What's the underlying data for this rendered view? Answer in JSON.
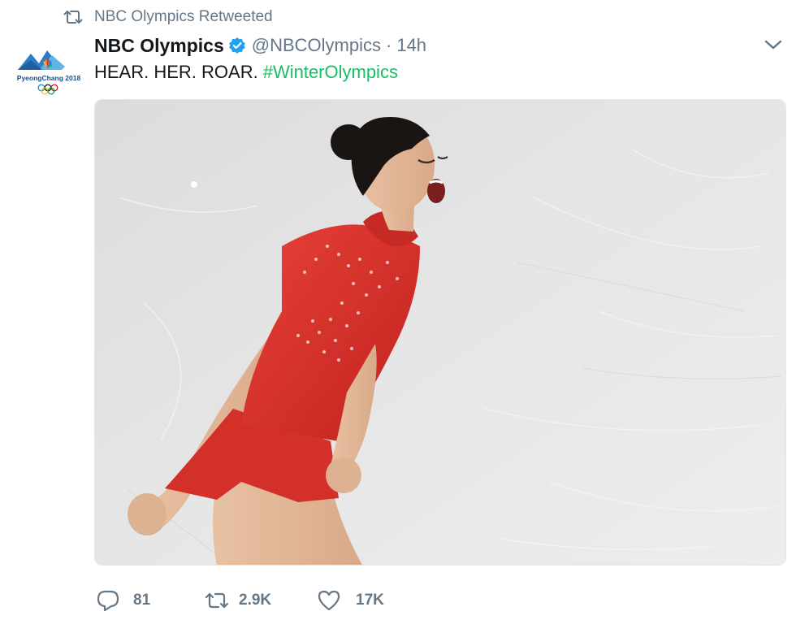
{
  "retweet_context": {
    "icon": "retweet-icon",
    "text": "NBC Olympics Retweeted"
  },
  "author": {
    "avatar_text": "PyeongChang 2018",
    "display_name": "NBC Olympics",
    "verified_icon": "verified-badge-icon",
    "handle": "@NBCOlympics",
    "separator": "·",
    "time": "14h"
  },
  "menu": {
    "icon": "chevron-down-icon"
  },
  "tweet": {
    "text": "HEAR. HER. ROAR.",
    "hashtag": "#WinterOlympics"
  },
  "media": {
    "type": "photo"
  },
  "actions": {
    "reply": {
      "icon": "reply-icon",
      "count": "81"
    },
    "retweet": {
      "icon": "retweet-icon",
      "count": "2.9K"
    },
    "like": {
      "icon": "heart-icon",
      "count": "17K"
    }
  },
  "colors": {
    "text_primary": "#14171a",
    "text_secondary": "#657786",
    "hashtag": "#17bf63",
    "verified": "#1da1f2",
    "border": "#e1e8ed"
  }
}
